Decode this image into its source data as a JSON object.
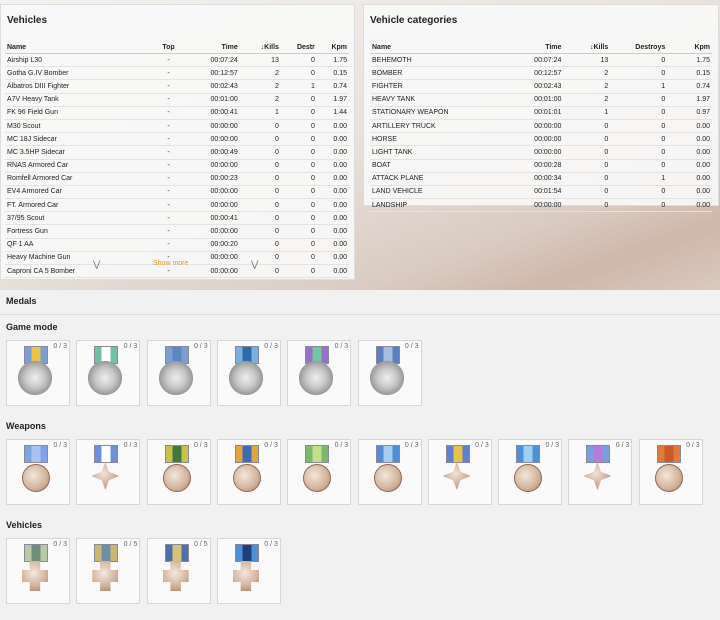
{
  "vehicles_panel": {
    "title": "Vehicles",
    "headers": [
      "Name",
      "Top",
      "Time",
      "↓Kills",
      "Destr",
      "Kpm"
    ],
    "rows": [
      [
        "Airship L30",
        "-",
        "00:07:24",
        "13",
        "0",
        "1.75"
      ],
      [
        "Gotha G.IV Bomber",
        "-",
        "00:12:57",
        "2",
        "0",
        "0.15"
      ],
      [
        "Albatros DIII Fighter",
        "-",
        "00:02:43",
        "2",
        "1",
        "0.74"
      ],
      [
        "A7V Heavy Tank",
        "-",
        "00:01:00",
        "2",
        "0",
        "1.97"
      ],
      [
        "FK 96 Field Gun",
        "-",
        "00:00:41",
        "1",
        "0",
        "1.44"
      ],
      [
        "M30 Scout",
        "-",
        "00:00:00",
        "0",
        "0",
        "0.00"
      ],
      [
        "MC 18J Sidecar",
        "-",
        "00:00:00",
        "0",
        "0",
        "0.00"
      ],
      [
        "MC 3.5HP Sidecar",
        "-",
        "00:00:49",
        "0",
        "0",
        "0.00"
      ],
      [
        "RNAS Armored Car",
        "-",
        "00:00:00",
        "0",
        "0",
        "0.00"
      ],
      [
        "Romfell Armored Car",
        "-",
        "00:00:23",
        "0",
        "0",
        "0.00"
      ],
      [
        "EV4 Armored Car",
        "-",
        "00:00:00",
        "0",
        "0",
        "0.00"
      ],
      [
        "FT. Armored Car",
        "-",
        "00:00:00",
        "0",
        "0",
        "0.00"
      ],
      [
        "37/95 Scout",
        "-",
        "00:00:41",
        "0",
        "0",
        "0.00"
      ],
      [
        "Fortress Gun",
        "-",
        "00:00:00",
        "0",
        "0",
        "0.00"
      ],
      [
        "QF 1 AA",
        "-",
        "00:00:20",
        "0",
        "0",
        "0.00"
      ],
      [
        "Heavy Machine Gun",
        "-",
        "00:00:00",
        "0",
        "0",
        "0.00"
      ],
      [
        "Caproni CA 5 Bomber",
        "-",
        "00:00:00",
        "0",
        "0",
        "0.00"
      ]
    ],
    "show_more_label": "Show more"
  },
  "categories_panel": {
    "title": "Vehicle categories",
    "headers": [
      "Name",
      "Time",
      "↓Kills",
      "Destroys",
      "Kpm"
    ],
    "rows": [
      [
        "BEHEMOTH",
        "00:07:24",
        "13",
        "0",
        "1.75"
      ],
      [
        "BOMBER",
        "00:12:57",
        "2",
        "0",
        "0.15"
      ],
      [
        "FIGHTER",
        "00:02:43",
        "2",
        "1",
        "0.74"
      ],
      [
        "HEAVY TANK",
        "00:01:00",
        "2",
        "0",
        "1.97"
      ],
      [
        "STATIONARY WEAPON",
        "00:01:01",
        "1",
        "0",
        "0.97"
      ],
      [
        "ARTILLERY TRUCK",
        "00:00:00",
        "0",
        "0",
        "0.00"
      ],
      [
        "HORSE",
        "00:00:00",
        "0",
        "0",
        "0.00"
      ],
      [
        "LIGHT TANK",
        "00:00:00",
        "0",
        "0",
        "0.00"
      ],
      [
        "BOAT",
        "00:00:28",
        "0",
        "0",
        "0.00"
      ],
      [
        "ATTACK PLANE",
        "00:00:34",
        "0",
        "1",
        "0.00"
      ],
      [
        "LAND VEHICLE",
        "00:01:54",
        "0",
        "0",
        "0.00"
      ],
      [
        "LANDSHIP",
        "00:00:00",
        "0",
        "0",
        "0.00"
      ]
    ]
  },
  "medals": {
    "title": "Medals",
    "sections": [
      {
        "title": "Game mode",
        "items": [
          {
            "count": "0 / 3",
            "ribbon": [
              "#7a9fd0",
              "#e8c44a",
              "#7a9fd0"
            ],
            "shape": "cross"
          },
          {
            "count": "0 / 3",
            "ribbon": [
              "#6fc1a0",
              "#ffffff",
              "#6fc1a0"
            ],
            "shape": "cross"
          },
          {
            "count": "0 / 3",
            "ribbon": [
              "#7a9fd0",
              "#5d86c4",
              "#7a9fd0"
            ],
            "shape": "cross"
          },
          {
            "count": "0 / 3",
            "ribbon": [
              "#7ab0e0",
              "#2c6ca8",
              "#7ab0e0"
            ],
            "shape": "cross"
          },
          {
            "count": "0 / 3",
            "ribbon": [
              "#9b6fc8",
              "#6fc8a0",
              "#9b6fc8"
            ],
            "shape": "cross"
          },
          {
            "count": "0 / 3",
            "ribbon": [
              "#5b7fc0",
              "#a7bce0",
              "#5b7fc0"
            ],
            "shape": "cross"
          }
        ]
      },
      {
        "title": "Weapons",
        "items": [
          {
            "count": "0 / 3",
            "ribbon": [
              "#7ea3e6",
              "#a9c3f0",
              "#7ea3e6"
            ],
            "shape": "round"
          },
          {
            "count": "0 / 3",
            "ribbon": [
              "#6f90d8",
              "#ffffff",
              "#6f90d8"
            ],
            "shape": "star"
          },
          {
            "count": "0 / 3",
            "ribbon": [
              "#c9c24a",
              "#3f7a3a",
              "#c9c24a"
            ],
            "shape": "round"
          },
          {
            "count": "0 / 3",
            "ribbon": [
              "#e0a63a",
              "#3b6cb8",
              "#e0a63a"
            ],
            "shape": "round"
          },
          {
            "count": "0 / 3",
            "ribbon": [
              "#7ab86a",
              "#c4df8a",
              "#7ab86a"
            ],
            "shape": "round"
          },
          {
            "count": "0 / 3",
            "ribbon": [
              "#4e8fd8",
              "#a7cdf0",
              "#4e8fd8"
            ],
            "shape": "round"
          },
          {
            "count": "0 / 3",
            "ribbon": [
              "#5f7fd0",
              "#e6c24a",
              "#5f7fd0"
            ],
            "shape": "star"
          },
          {
            "count": "0 / 3",
            "ribbon": [
              "#4f8fd8",
              "#9fd0f0",
              "#4f8fd8"
            ],
            "shape": "round"
          },
          {
            "count": "0 / 3",
            "ribbon": [
              "#7a9fe0",
              "#b87adf",
              "#7a9fe0"
            ],
            "shape": "star"
          },
          {
            "count": "0 / 3",
            "ribbon": [
              "#e07a3a",
              "#c95a2a",
              "#e07a3a"
            ],
            "shape": "round"
          }
        ]
      },
      {
        "title": "Vehicles",
        "items": [
          {
            "count": "0 / 3",
            "ribbon": [
              "#b8c8a8",
              "#6f8f7a",
              "#b8c8a8"
            ],
            "shape": "crossv"
          },
          {
            "count": "0 / 5",
            "ribbon": [
              "#c9b872",
              "#6f8fa8",
              "#c9b872"
            ],
            "shape": "crossv"
          },
          {
            "count": "0 / 5",
            "ribbon": [
              "#4f6fa8",
              "#d8c27a",
              "#4f6fa8"
            ],
            "shape": "crossv"
          },
          {
            "count": "0 / 3",
            "ribbon": [
              "#4f8fd8",
              "#1f3f7a",
              "#4f8fd8"
            ],
            "shape": "crossv"
          }
        ]
      }
    ]
  }
}
